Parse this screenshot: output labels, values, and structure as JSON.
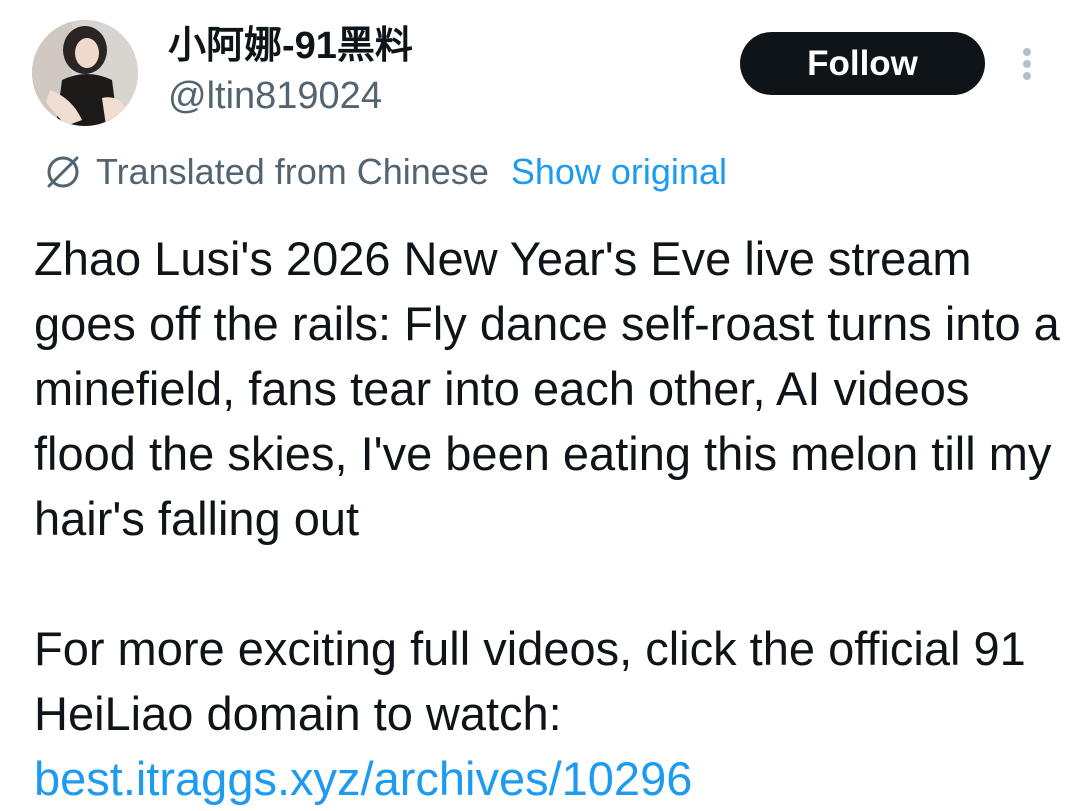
{
  "author": {
    "display_name": "小阿娜-91黑料",
    "handle": "@ltin819024"
  },
  "follow_label": "Follow",
  "translation": {
    "translated_label": "Translated from Chinese",
    "show_original_label": "Show original"
  },
  "tweet": {
    "paragraph_1": "Zhao Lusi's 2026 New Year's Eve live stream goes off the rails: Fly dance self-roast turns into a minefield, fans tear into each other, AI videos flood the skies, I've been eating this melon till my hair's falling out",
    "paragraph_2": "For more exciting full videos, click the official 91 HeiLiao domain to watch:",
    "link": "best.itraggs.xyz/archives/10296"
  },
  "colors": {
    "text": "#0f1419",
    "secondary": "#536471",
    "link": "#1d9bf0",
    "button_bg": "#0f1419"
  }
}
